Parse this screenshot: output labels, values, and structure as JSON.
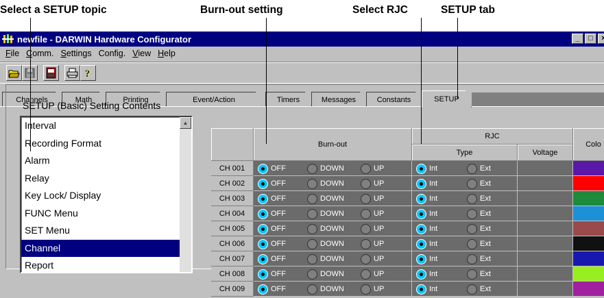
{
  "callouts": {
    "select_setup_topic": "Select a SETUP topic",
    "burnout_setting": "Burn-out setting",
    "select_rjc": "Select RJC",
    "setup_tab": "SETUP tab"
  },
  "window": {
    "title": "newfile - DARWIN Hardware Configurator",
    "controls": [
      "_",
      "□",
      "×"
    ]
  },
  "menu": [
    {
      "mnemonic": "F",
      "rest": "ile"
    },
    {
      "mnemonic": "C",
      "rest": "omm."
    },
    {
      "mnemonic": "S",
      "rest": "ettings"
    },
    {
      "mnemonic": "",
      "rest": "Config.",
      "underline_index": 6
    },
    {
      "mnemonic": "V",
      "rest": "iew"
    },
    {
      "mnemonic": "H",
      "rest": "elp"
    }
  ],
  "toolbar": {
    "icons": [
      "open-folder-icon",
      "save-disk-icon",
      "download-icon",
      "print-icon",
      "help-icon"
    ]
  },
  "tabs": [
    "Channels",
    "Math",
    "Printing",
    "Event/Action",
    "Timers",
    "Messages",
    "Constants",
    "SETUP"
  ],
  "active_tab": "SETUP",
  "setup_panel": {
    "heading": "SETUP (Basic) Setting Contents",
    "items": [
      "Interval",
      "Recording Format",
      "Alarm",
      "Relay",
      "Key Lock/ Display",
      "FUNC Menu",
      "SET Menu",
      "Channel",
      "Report"
    ],
    "selected": "Channel"
  },
  "grid": {
    "headers": {
      "burnout": "Burn-out",
      "rjc": "RJC",
      "type": "Type",
      "voltage": "Voltage",
      "color": "Colo"
    },
    "burnout_options": [
      "OFF",
      "DOWN",
      "UP"
    ],
    "rjc_options": [
      "Int",
      "Ext"
    ],
    "rows": [
      {
        "ch": "CH 001",
        "burnout": "OFF",
        "rjc": "Int",
        "color": "#5a18a8"
      },
      {
        "ch": "CH 002",
        "burnout": "OFF",
        "rjc": "Int",
        "color": "#ff0000"
      },
      {
        "ch": "CH 003",
        "burnout": "OFF",
        "rjc": "Int",
        "color": "#1e8a3a"
      },
      {
        "ch": "CH 004",
        "burnout": "OFF",
        "rjc": "Int",
        "color": "#1e90d8"
      },
      {
        "ch": "CH 005",
        "burnout": "OFF",
        "rjc": "Int",
        "color": "#9a4a4a"
      },
      {
        "ch": "CH 006",
        "burnout": "OFF",
        "rjc": "Int",
        "color": "#111111"
      },
      {
        "ch": "CH 007",
        "burnout": "OFF",
        "rjc": "Int",
        "color": "#1818b0"
      },
      {
        "ch": "CH 008",
        "burnout": "OFF",
        "rjc": "Int",
        "color": "#99ee22"
      },
      {
        "ch": "CH 009",
        "burnout": "OFF",
        "rjc": "Int",
        "color": "#a020a0"
      }
    ]
  }
}
